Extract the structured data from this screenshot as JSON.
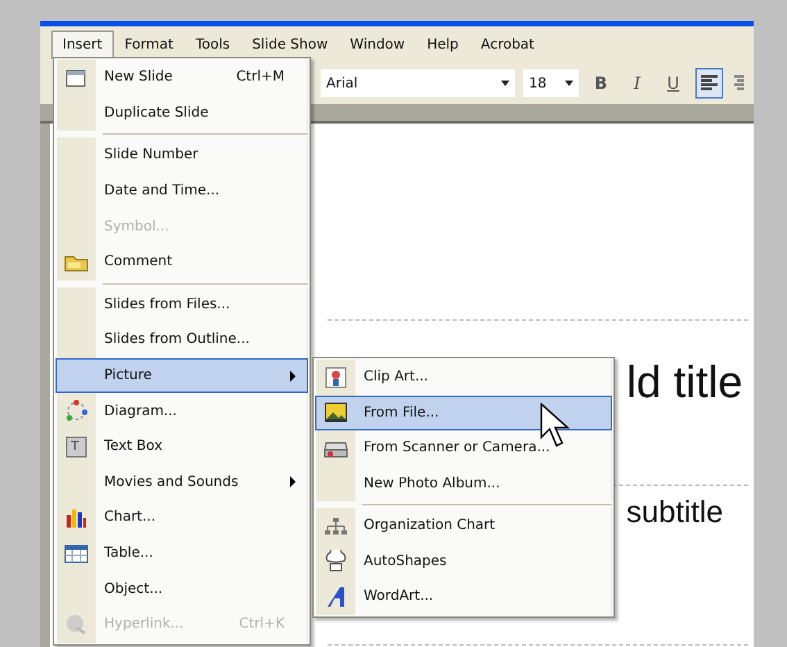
{
  "menubar": [
    {
      "label": "Insert",
      "selected": true
    },
    {
      "label": "Format",
      "selected": false
    },
    {
      "label": "Tools",
      "selected": false
    },
    {
      "label": "Slide Show",
      "selected": false
    },
    {
      "label": "Window",
      "selected": false
    },
    {
      "label": "Help",
      "selected": false
    },
    {
      "label": "Acrobat",
      "selected": false
    }
  ],
  "toolbar": {
    "font": "Arial",
    "size": "18",
    "buttons": [
      {
        "kind": "bold",
        "label": "B",
        "selected": false
      },
      {
        "kind": "italic",
        "label": "I",
        "selected": false
      },
      {
        "kind": "underline",
        "label": "U",
        "selected": false
      },
      {
        "kind": "align-left",
        "selected": true
      },
      {
        "kind": "align-center",
        "selected": false
      }
    ]
  },
  "slide": {
    "title": "ld title",
    "subtitle": "subtitle"
  },
  "insert_menu": {
    "items": [
      {
        "kind": "item",
        "label": "New Slide",
        "shortcut": "Ctrl+M",
        "disabled": false,
        "selected": false
      },
      {
        "kind": "item",
        "label": "Duplicate Slide",
        "disabled": false,
        "selected": false
      },
      {
        "kind": "separator"
      },
      {
        "kind": "item",
        "label": "Slide Number",
        "disabled": false,
        "selected": false
      },
      {
        "kind": "item",
        "label": "Date and Time...",
        "disabled": false,
        "selected": false
      },
      {
        "kind": "item",
        "label": "Symbol...",
        "disabled": true,
        "selected": false
      },
      {
        "kind": "item",
        "label": "Comment",
        "disabled": false,
        "selected": false
      },
      {
        "kind": "separator"
      },
      {
        "kind": "item",
        "label": "Slides from Files...",
        "disabled": false,
        "selected": false
      },
      {
        "kind": "item",
        "label": "Slides from Outline...",
        "disabled": false,
        "selected": false
      },
      {
        "kind": "submenu",
        "label": "Picture",
        "disabled": false,
        "selected": true
      },
      {
        "kind": "item",
        "label": "Diagram...",
        "disabled": false,
        "selected": false
      },
      {
        "kind": "item",
        "label": "Text Box",
        "disabled": false,
        "selected": false
      },
      {
        "kind": "submenu",
        "label": "Movies and Sounds",
        "disabled": false,
        "selected": false
      },
      {
        "kind": "item",
        "label": "Chart...",
        "disabled": false,
        "selected": false
      },
      {
        "kind": "item",
        "label": "Table...",
        "disabled": false,
        "selected": false
      },
      {
        "kind": "item",
        "label": "Object...",
        "disabled": false,
        "selected": false
      },
      {
        "kind": "item",
        "label": "Hyperlink...",
        "shortcut": "Ctrl+K",
        "disabled": true,
        "selected": false
      }
    ]
  },
  "picture_submenu": {
    "items": [
      {
        "kind": "item",
        "label": "Clip Art...",
        "selected": false
      },
      {
        "kind": "item",
        "label": "From File...",
        "selected": true
      },
      {
        "kind": "item",
        "label": "From Scanner or Camera...",
        "selected": false
      },
      {
        "kind": "item",
        "label": "New Photo Album...",
        "selected": false
      },
      {
        "kind": "separator"
      },
      {
        "kind": "item",
        "label": "Organization Chart",
        "selected": false
      },
      {
        "kind": "item",
        "label": "AutoShapes",
        "selected": false
      },
      {
        "kind": "item",
        "label": "WordArt...",
        "selected": false
      }
    ]
  }
}
